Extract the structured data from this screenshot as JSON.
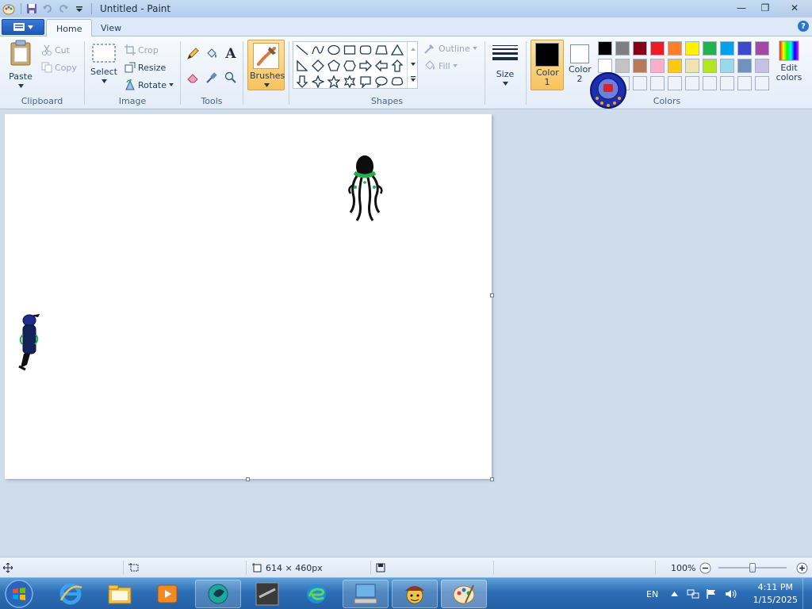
{
  "window": {
    "title": "Untitled - Paint",
    "minimize_glyph": "—",
    "restore_glyph": "❐",
    "close_glyph": "✕"
  },
  "tabs": [
    {
      "label": "Home",
      "active": true
    },
    {
      "label": "View",
      "active": false
    }
  ],
  "help_glyph": "?",
  "clipboard": {
    "paste_label": "Paste",
    "cut_label": "Cut",
    "copy_label": "Copy",
    "group_label": "Clipboard"
  },
  "image": {
    "select_label": "Select",
    "crop_label": "Crop",
    "resize_label": "Resize",
    "rotate_label": "Rotate",
    "group_label": "Image"
  },
  "tools": {
    "group_label": "Tools",
    "text_glyph": "A"
  },
  "brushes": {
    "label": "Brushes"
  },
  "shapes": {
    "outline_label": "Outline",
    "fill_label": "Fill",
    "group_label": "Shapes"
  },
  "size": {
    "label": "Size"
  },
  "colors": {
    "color1_label": "Color 1",
    "color1_value": "#000000",
    "color2_label": "Color 2",
    "color2_value": "#ffffff",
    "edit_label": "Edit colors",
    "group_label": "Colors",
    "palette_row1": [
      "#000000",
      "#7f7f7f",
      "#880015",
      "#ed1c24",
      "#ff7f27",
      "#fff200",
      "#22b14c",
      "#00a2e8",
      "#3f48cc",
      "#a349a4"
    ],
    "palette_row2": [
      "#ffffff",
      "#c3c3c3",
      "#b97a57",
      "#ffaec9",
      "#ffc90e",
      "#efe4b0",
      "#b5e61d",
      "#99d9ea",
      "#7092be",
      "#c8bfe7"
    ]
  },
  "statusbar": {
    "dimensions": "614 × 460px",
    "zoom": "100%",
    "zoom_level": 0.5
  },
  "taskbar": {
    "language": "EN",
    "time": "4:11 PM",
    "date": "1/15/2025"
  }
}
